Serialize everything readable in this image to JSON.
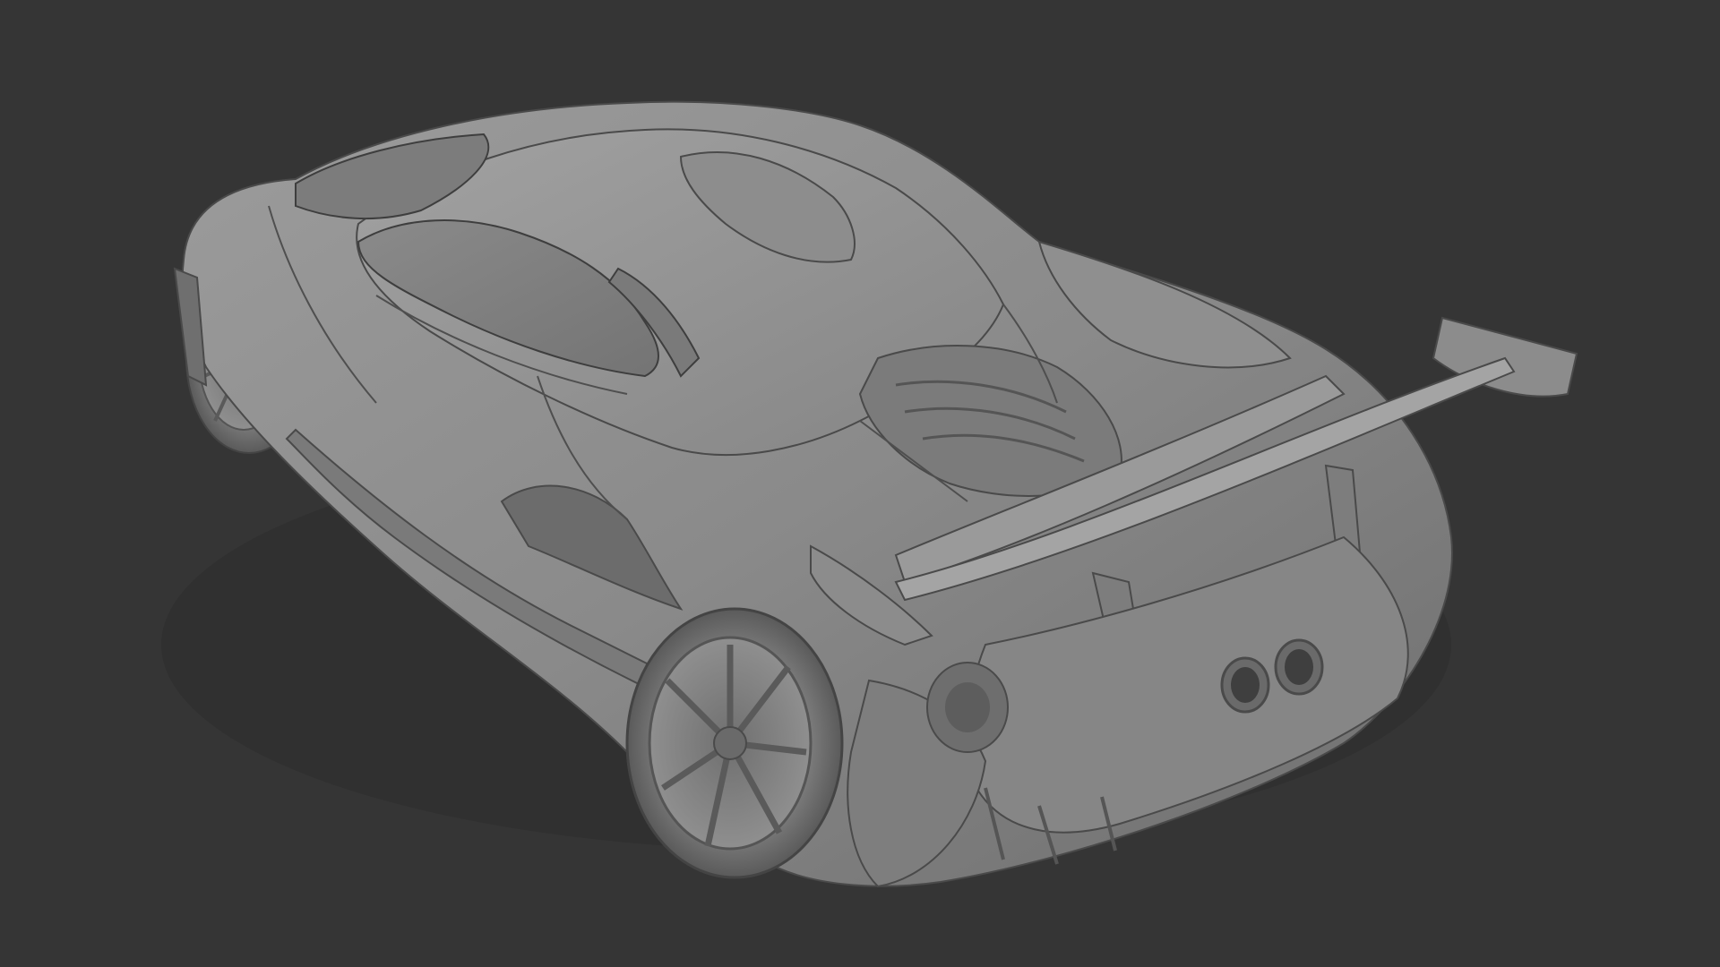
{
  "viewport": {
    "background_color": "#353535",
    "render_style": "clay / solid grey shading",
    "subject": "race-car-3d-model"
  },
  "model": {
    "body_color": "#8e8e8e",
    "highlight_color": "#a9a9a9",
    "shadow_color": "#5a5a5a",
    "line_color": "#3e3e3e",
    "glass_color": "#7f7f7f"
  }
}
